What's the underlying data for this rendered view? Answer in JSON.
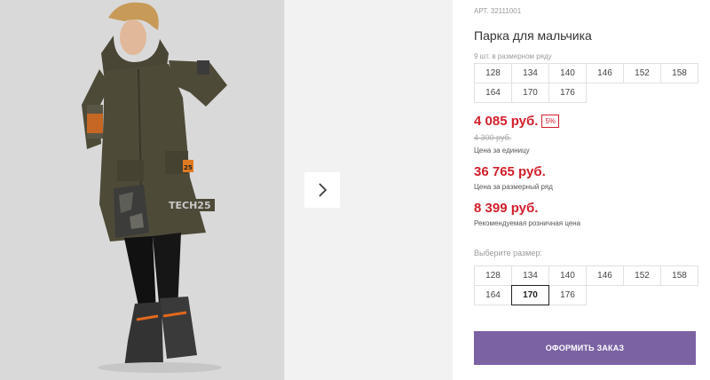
{
  "product": {
    "sku": "АРТ. 32111001",
    "title": "Парка для мальчика",
    "pack_label": "9 шт. в размерном ряду",
    "pack_sizes": [
      "128",
      "134",
      "140",
      "146",
      "152",
      "158",
      "164",
      "170",
      "176"
    ]
  },
  "pricing": {
    "unit_price": "4 085 руб.",
    "discount": "5%",
    "old_price": "4 300 руб.",
    "unit_note": "Цена за единицу",
    "pack_price": "36 765 руб.",
    "pack_note": "Цена за размерный ряд",
    "retail_price": "8 399 руб.",
    "retail_note": "Рекомендуемая розничная цена"
  },
  "size_picker": {
    "label": "Выберите размер:",
    "sizes": [
      "128",
      "134",
      "140",
      "146",
      "152",
      "158",
      "164",
      "170",
      "176"
    ],
    "selected": "170"
  },
  "actions": {
    "order_label": "ОФОРМИТЬ ЗАКАЗ"
  },
  "gallery": {
    "next_icon": "chevron-right-icon",
    "photo_patch_text": "TECH25",
    "photo_badge_text": "25"
  },
  "colors": {
    "price_red": "#d21f2b",
    "button_purple": "#7b62a3",
    "parka_khaki": "#4e4a38"
  }
}
